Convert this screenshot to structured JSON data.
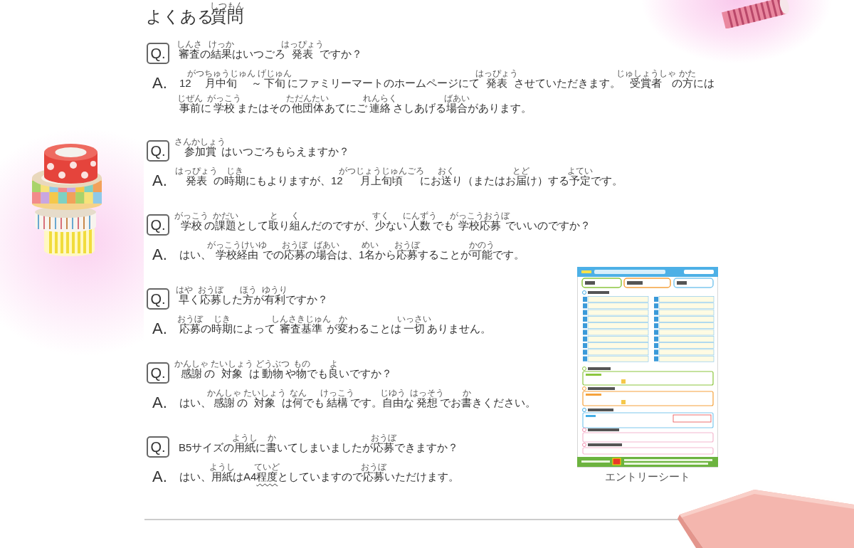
{
  "title": [
    {
      "text": "よくある"
    },
    {
      "text": "質問",
      "ruby": "しつもん"
    }
  ],
  "faq": [
    {
      "q_mark": "Q.",
      "question": [
        {
          "text": "審査",
          "ruby": "しんさ"
        },
        {
          "text": "の"
        },
        {
          "text": "結果",
          "ruby": "けっか"
        },
        {
          "text": "はいつごろ"
        },
        {
          "text": "発表",
          "ruby": "はっぴょう"
        },
        {
          "text": "ですか？"
        }
      ],
      "a_mark": "A.",
      "answer": [
        {
          "text": "12"
        },
        {
          "text": "月中旬",
          "ruby": "がつちゅうじゅん"
        },
        {
          "text": "～"
        },
        {
          "text": "下旬",
          "ruby": "げじゅん"
        },
        {
          "text": "にファミリーマートのホームページにて"
        },
        {
          "text": "発表",
          "ruby": "はっぴょう"
        },
        {
          "text": "させていただきます。"
        },
        {
          "text": "受賞者",
          "ruby": "じゅしょうしゃ"
        },
        {
          "text": "の"
        },
        {
          "text": "方",
          "ruby": "かた"
        },
        {
          "text": "には"
        },
        {
          "text": "事前",
          "ruby": "じぜん"
        },
        {
          "text": "に"
        },
        {
          "text": "学校",
          "ruby": "がっこう"
        },
        {
          "text": "またはその"
        },
        {
          "text": "他団体",
          "ruby": "ただんたい"
        },
        {
          "text": "あてにご"
        },
        {
          "text": "連絡",
          "ruby": "れんらく"
        },
        {
          "text": "さしあげる"
        },
        {
          "text": "場合",
          "ruby": "ばあい"
        },
        {
          "text": "があります。"
        }
      ]
    },
    {
      "q_mark": "Q.",
      "question": [
        {
          "text": "参加賞",
          "ruby": "さんかしょう"
        },
        {
          "text": "はいつごろもらえますか？"
        }
      ],
      "a_mark": "A.",
      "answer": [
        {
          "text": "発表",
          "ruby": "はっぴょう"
        },
        {
          "text": "の"
        },
        {
          "text": "時期",
          "ruby": "じき"
        },
        {
          "text": "にもよりますが、12"
        },
        {
          "text": "月上旬頃",
          "ruby": "がつじょうじゅんごろ"
        },
        {
          "text": "にお"
        },
        {
          "text": "送",
          "ruby": "おく"
        },
        {
          "text": "り（またはお"
        },
        {
          "text": "届",
          "ruby": "とど"
        },
        {
          "text": "け）する"
        },
        {
          "text": "予定",
          "ruby": "よてい"
        },
        {
          "text": "です。"
        }
      ]
    },
    {
      "q_mark": "Q.",
      "question": [
        {
          "text": "学校",
          "ruby": "がっこう"
        },
        {
          "text": "の"
        },
        {
          "text": "課題",
          "ruby": "かだい"
        },
        {
          "text": "として"
        },
        {
          "text": "取",
          "ruby": "と"
        },
        {
          "text": "り"
        },
        {
          "text": "組",
          "ruby": "く"
        },
        {
          "text": "んだのですが、"
        },
        {
          "text": "少",
          "ruby": "すく"
        },
        {
          "text": "ない"
        },
        {
          "text": "人数",
          "ruby": "にんずう"
        },
        {
          "text": "でも"
        },
        {
          "text": "学校応募",
          "ruby": "がっこうおうぼ"
        },
        {
          "text": "でいいのですか？"
        }
      ],
      "a_mark": "A.",
      "answer": [
        {
          "text": "はい、"
        },
        {
          "text": "学校経由",
          "ruby": "がっこうけいゆ"
        },
        {
          "text": "での"
        },
        {
          "text": "応募",
          "ruby": "おうぼ"
        },
        {
          "text": "の"
        },
        {
          "text": "場合",
          "ruby": "ばあい"
        },
        {
          "text": "は、1"
        },
        {
          "text": "名",
          "ruby": "めい"
        },
        {
          "text": "から"
        },
        {
          "text": "応募",
          "ruby": "おうぼ"
        },
        {
          "text": "することが"
        },
        {
          "text": "可能",
          "ruby": "かのう"
        },
        {
          "text": "です。"
        }
      ]
    },
    {
      "q_mark": "Q.",
      "question": [
        {
          "text": "早",
          "ruby": "はや"
        },
        {
          "text": "く"
        },
        {
          "text": "応募",
          "ruby": "おうぼ"
        },
        {
          "text": "した"
        },
        {
          "text": "方",
          "ruby": "ほう"
        },
        {
          "text": "が"
        },
        {
          "text": "有利",
          "ruby": "ゆうり"
        },
        {
          "text": "ですか？"
        }
      ],
      "a_mark": "A.",
      "answer": [
        {
          "text": "応募",
          "ruby": "おうぼ"
        },
        {
          "text": "の"
        },
        {
          "text": "時期",
          "ruby": "じき"
        },
        {
          "text": "によって"
        },
        {
          "text": "審査基準",
          "ruby": "しんさきじゅん"
        },
        {
          "text": "が"
        },
        {
          "text": "変",
          "ruby": "か"
        },
        {
          "text": "わることは"
        },
        {
          "text": "一切",
          "ruby": "いっさい"
        },
        {
          "text": "ありません。"
        }
      ]
    },
    {
      "q_mark": "Q.",
      "question": [
        {
          "text": "感謝",
          "ruby": "かんしゃ"
        },
        {
          "text": "の"
        },
        {
          "text": "対象",
          "ruby": "たいしょう"
        },
        {
          "text": "は"
        },
        {
          "text": "動物",
          "ruby": "どうぶつ"
        },
        {
          "text": "や"
        },
        {
          "text": "物",
          "ruby": "もの"
        },
        {
          "text": "でも"
        },
        {
          "text": "良",
          "ruby": "よ"
        },
        {
          "text": "いですか？"
        }
      ],
      "a_mark": "A.",
      "answer": [
        {
          "text": "はい、"
        },
        {
          "text": "感謝",
          "ruby": "かんしゃ"
        },
        {
          "text": "の"
        },
        {
          "text": "対象",
          "ruby": "たいしょう"
        },
        {
          "text": "は"
        },
        {
          "text": "何",
          "ruby": "なん"
        },
        {
          "text": "でも"
        },
        {
          "text": "結構",
          "ruby": "けっこう"
        },
        {
          "text": "です。"
        },
        {
          "text": "自由",
          "ruby": "じゆう"
        },
        {
          "text": "な"
        },
        {
          "text": "発想",
          "ruby": "はっそう"
        },
        {
          "text": "でお"
        },
        {
          "text": "書",
          "ruby": "か"
        },
        {
          "text": "きください。"
        }
      ]
    },
    {
      "q_mark": "Q.",
      "question": [
        {
          "text": "B5サイズの"
        },
        {
          "text": "用紙",
          "ruby": "ようし"
        },
        {
          "text": "に"
        },
        {
          "text": "書",
          "ruby": "か"
        },
        {
          "text": "いてしまいましたが"
        },
        {
          "text": "応募",
          "ruby": "おうぼ"
        },
        {
          "text": "できますか？"
        }
      ],
      "a_mark": "A.",
      "answer": [
        {
          "text": "はい、"
        },
        {
          "text": "用紙",
          "ruby": "ようし"
        },
        {
          "text": "はA4"
        },
        {
          "text": "程度",
          "ruby": "ていど",
          "underlined": true
        },
        {
          "text": "としていますので"
        },
        {
          "text": "応募",
          "ruby": "おうぼ"
        },
        {
          "text": "いただけます。"
        }
      ]
    }
  ],
  "entry_sheet": {
    "caption": "エントリーシート"
  }
}
